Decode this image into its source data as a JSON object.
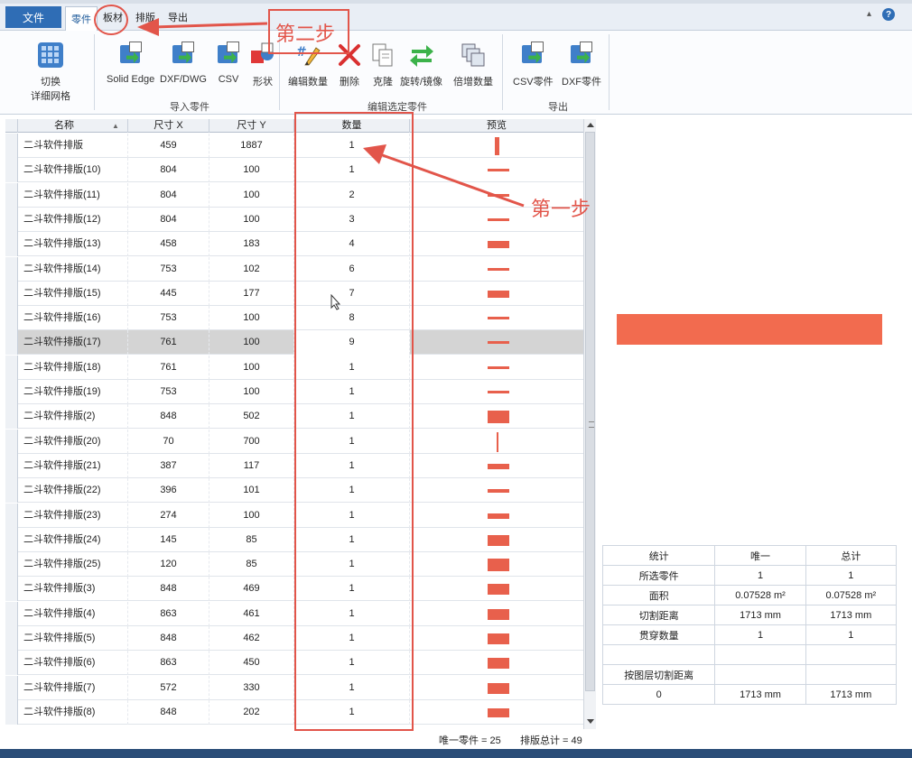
{
  "menu": {
    "file_label": "文件",
    "tabs": [
      {
        "label": "零件",
        "active": true
      },
      {
        "label": "板材"
      },
      {
        "label": "排版"
      },
      {
        "label": "导出"
      }
    ]
  },
  "ribbon": {
    "toggle": {
      "line1": "切换",
      "line2": "详细网格"
    },
    "import_group": {
      "label": "导入零件",
      "buttons": [
        "Solid Edge",
        "DXF/DWG",
        "CSV",
        "形状"
      ]
    },
    "edit_group": {
      "label": "编辑选定零件",
      "buttons": [
        "编辑数量",
        "删除",
        "克隆",
        "旋转/镜像",
        "倍增数量"
      ]
    },
    "export_group": {
      "label": "导出",
      "buttons": [
        "CSV零件",
        "DXF零件"
      ]
    }
  },
  "grid": {
    "columns": [
      "名称",
      "尺寸 X",
      "尺寸 Y",
      "数量",
      "预览"
    ],
    "rows": [
      {
        "name": "二斗软件排版",
        "x": "459",
        "y": "1887",
        "qty": "1",
        "preview": [
          548,
          8,
          5,
          20
        ]
      },
      {
        "name": "二斗软件排版(10)",
        "x": "804",
        "y": "100",
        "qty": "1",
        "preview": [
          540,
          0,
          24,
          3
        ]
      },
      {
        "name": "二斗软件排版(11)",
        "x": "804",
        "y": "100",
        "qty": "2",
        "preview": [
          540,
          0,
          24,
          3
        ]
      },
      {
        "name": "二斗软件排版(12)",
        "x": "804",
        "y": "100",
        "qty": "3",
        "preview": [
          540,
          0,
          24,
          3
        ]
      },
      {
        "name": "二斗软件排版(13)",
        "x": "458",
        "y": "183",
        "qty": "4",
        "preview": [
          540,
          0,
          24,
          8
        ]
      },
      {
        "name": "二斗软件排版(14)",
        "x": "753",
        "y": "102",
        "qty": "6",
        "preview": [
          540,
          0,
          24,
          3
        ]
      },
      {
        "name": "二斗软件排版(15)",
        "x": "445",
        "y": "177",
        "qty": "7",
        "preview": [
          540,
          0,
          24,
          8
        ]
      },
      {
        "name": "二斗软件排版(16)",
        "x": "753",
        "y": "100",
        "qty": "8",
        "preview": [
          540,
          0,
          24,
          3
        ]
      },
      {
        "name": "二斗软件排版(17)",
        "x": "761",
        "y": "100",
        "qty": "9",
        "preview": [
          540,
          0,
          24,
          3
        ],
        "selected": true
      },
      {
        "name": "二斗软件排版(18)",
        "x": "761",
        "y": "100",
        "qty": "1",
        "preview": [
          540,
          0,
          24,
          3
        ]
      },
      {
        "name": "二斗软件排版(19)",
        "x": "753",
        "y": "100",
        "qty": "1",
        "preview": [
          540,
          0,
          24,
          3
        ]
      },
      {
        "name": "二斗软件排版(2)",
        "x": "848",
        "y": "502",
        "qty": "1",
        "preview": [
          540,
          0,
          24,
          14
        ]
      },
      {
        "name": "二斗软件排版(20)",
        "x": "70",
        "y": "700",
        "qty": "1",
        "preview": [
          550,
          0,
          2,
          22
        ]
      },
      {
        "name": "二斗软件排版(21)",
        "x": "387",
        "y": "117",
        "qty": "1",
        "preview": [
          540,
          0,
          24,
          6
        ]
      },
      {
        "name": "二斗软件排版(22)",
        "x": "396",
        "y": "101",
        "qty": "1",
        "preview": [
          540,
          0,
          24,
          4
        ]
      },
      {
        "name": "二斗软件排版(23)",
        "x": "274",
        "y": "100",
        "qty": "1",
        "preview": [
          540,
          0,
          24,
          6
        ]
      },
      {
        "name": "二斗软件排版(24)",
        "x": "145",
        "y": "85",
        "qty": "1",
        "preview": [
          540,
          0,
          24,
          12
        ]
      },
      {
        "name": "二斗软件排版(25)",
        "x": "120",
        "y": "85",
        "qty": "1",
        "preview": [
          540,
          0,
          24,
          14
        ]
      },
      {
        "name": "二斗软件排版(3)",
        "x": "848",
        "y": "469",
        "qty": "1",
        "preview": [
          540,
          0,
          24,
          12
        ]
      },
      {
        "name": "二斗软件排版(4)",
        "x": "863",
        "y": "461",
        "qty": "1",
        "preview": [
          540,
          0,
          24,
          12
        ]
      },
      {
        "name": "二斗软件排版(5)",
        "x": "848",
        "y": "462",
        "qty": "1",
        "preview": [
          540,
          0,
          24,
          12
        ]
      },
      {
        "name": "二斗软件排版(6)",
        "x": "863",
        "y": "450",
        "qty": "1",
        "preview": [
          540,
          0,
          24,
          12
        ]
      },
      {
        "name": "二斗软件排版(7)",
        "x": "572",
        "y": "330",
        "qty": "1",
        "preview": [
          540,
          0,
          24,
          12
        ]
      },
      {
        "name": "二斗软件排版(8)",
        "x": "848",
        "y": "202",
        "qty": "1",
        "preview": [
          540,
          0,
          24,
          10
        ]
      }
    ]
  },
  "status": {
    "unique_parts": "唯一零件 = 25",
    "nest_total": "排版总计 = 49"
  },
  "stats": {
    "header": [
      "统计",
      "唯一",
      "总计"
    ],
    "rows": [
      [
        "所选零件",
        "1",
        "1"
      ],
      [
        "面积",
        "0.07528 m²",
        "0.07528 m²"
      ],
      [
        "切割距离",
        "1713 mm",
        "1713 mm"
      ],
      [
        "贯穿数量",
        "1",
        "1"
      ],
      [
        "",
        "",
        ""
      ],
      [
        "按图层切割距离",
        "",
        ""
      ],
      [
        "0",
        "1713 mm",
        "1713 mm"
      ]
    ]
  },
  "annotations": {
    "step1": "第一步",
    "step2": "第二步"
  },
  "colors": {
    "accent": "#2f6db5",
    "annotation": "#e2554a",
    "part": "#f26b4f"
  }
}
